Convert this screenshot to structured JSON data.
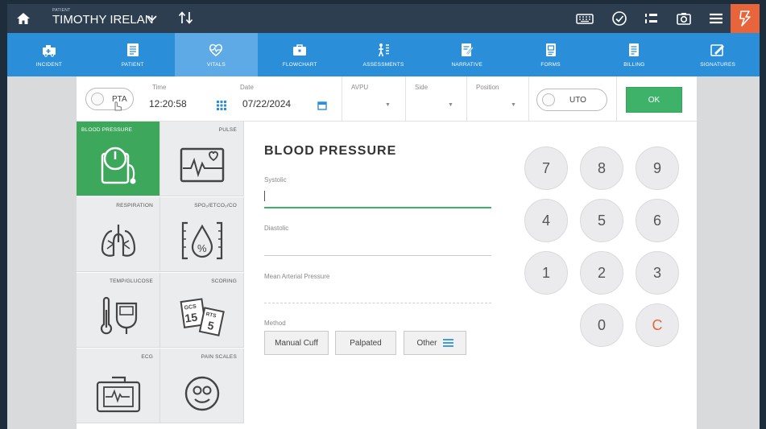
{
  "topbar": {
    "patient_label": "PATIENT",
    "patient_name": "TIMOTHY IRELAN",
    "icons": [
      "home-icon",
      "chevron-down-icon",
      "sort-icon",
      "keyboard-icon",
      "check-circle-icon",
      "list-icon",
      "camera-icon",
      "menu-icon",
      "lightning-icon"
    ]
  },
  "nav": [
    {
      "label": "INCIDENT",
      "icon": "ambulance-icon"
    },
    {
      "label": "PATIENT",
      "icon": "patient-chart-icon"
    },
    {
      "label": "VITALS",
      "icon": "heart-pulse-icon"
    },
    {
      "label": "FLOWCHART",
      "icon": "briefcase-icon"
    },
    {
      "label": "ASSESSMENTS",
      "icon": "body-icon"
    },
    {
      "label": "NARRATIVE",
      "icon": "edit-document-icon"
    },
    {
      "label": "FORMS",
      "icon": "form-icon"
    },
    {
      "label": "BILLING",
      "icon": "billing-icon"
    },
    {
      "label": "SIGNATURES",
      "icon": "signature-icon"
    }
  ],
  "formbar": {
    "pta_label": "PTA",
    "time_label": "Time",
    "time_value": "12:20:58",
    "date_label": "Date",
    "date_value": "07/22/2024",
    "avpu_label": "AVPU",
    "side_label": "Side",
    "position_label": "Position",
    "uto_label": "UTO",
    "ok_label": "OK"
  },
  "tiles": [
    {
      "label": "BLOOD PRESSURE",
      "icon": "blood-pressure-icon",
      "active": true
    },
    {
      "label": "PULSE",
      "icon": "pulse-monitor-icon"
    },
    {
      "label": "RESPIRATION",
      "icon": "lungs-icon"
    },
    {
      "label": "SPO₂/ETCO₂/CO",
      "icon": "oxygen-drop-icon"
    },
    {
      "label": "TEMP/GLUCOSE",
      "icon": "thermometer-icon"
    },
    {
      "label": "SCORING",
      "icon": "scoring-cards-icon"
    },
    {
      "label": "ECG",
      "icon": "ecg-monitor-icon"
    },
    {
      "label": "PAIN SCALES",
      "icon": "smiley-face-icon"
    }
  ],
  "scoring_cards": {
    "gcs": "GCS",
    "gcs_value": "15",
    "rts": "RTS",
    "rts_value": "5"
  },
  "main": {
    "title": "BLOOD PRESSURE",
    "systolic_label": "Systolic",
    "diastolic_label": "Diastolic",
    "map_label": "Mean Arterial Pressure",
    "method_label": "Method",
    "methods": [
      "Manual Cuff",
      "Palpated",
      "Other"
    ]
  },
  "keypad": [
    "7",
    "8",
    "9",
    "4",
    "5",
    "6",
    "1",
    "2",
    "3",
    "0",
    "C"
  ],
  "colors": {
    "topbar": "#2c3e50",
    "nav": "#2b8ed8",
    "nav_active": "#5eaae6",
    "accent_green": "#3fb26a",
    "alert_orange": "#e8643a"
  }
}
